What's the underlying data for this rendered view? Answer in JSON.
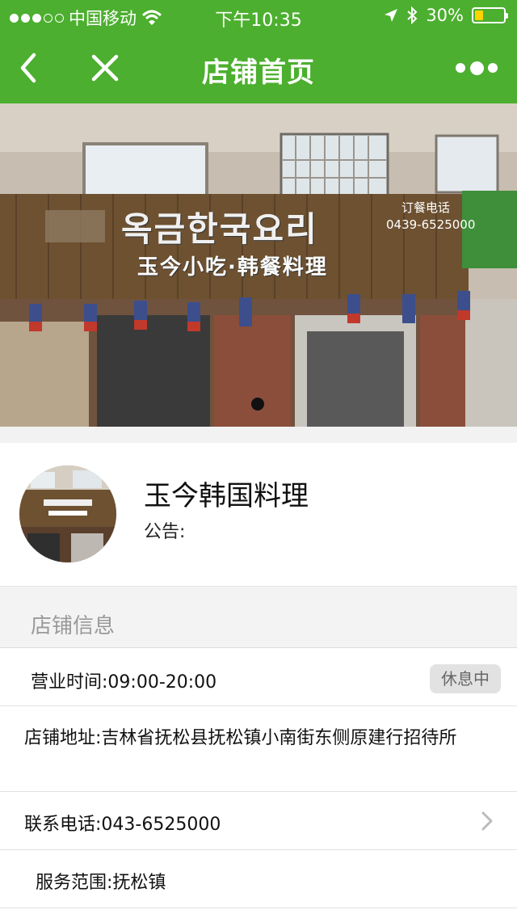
{
  "status_bar": {
    "carrier": "中国移动",
    "time": "下午10:35",
    "battery": "30%",
    "battery_level": 0.3
  },
  "nav": {
    "title": "店铺首页"
  },
  "banner": {
    "sign_korean": "옥금한국요리",
    "sign_chinese": "玉今小吃·韩餐料理",
    "phone_label": "订餐电话",
    "phone": "0439-6525000"
  },
  "shop": {
    "name": "玉今韩国料理",
    "notice": "公告:"
  },
  "section": {
    "title": "店铺信息"
  },
  "info": {
    "hours": "营业时间:09:00-20:00",
    "hours_status": "休息中",
    "address": "店铺地址:吉林省抚松县抚松镇小南街东侧原建行招待所",
    "phone": "联系电话:043-6525000",
    "service": "服务范围:抚松镇"
  },
  "colors": {
    "brand": "#4caf2f",
    "battery": "#ffd400"
  }
}
